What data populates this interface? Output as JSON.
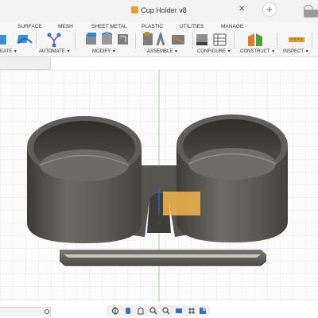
{
  "window": {
    "title": "Cup Holder v8",
    "close_glyph": "✕",
    "new_tab_glyph": "+"
  },
  "toolbar": {
    "tabs": [
      "SURFACE",
      "MESH",
      "SHEET METAL",
      "PLASTIC",
      "UTILITIES",
      "MANAGE"
    ],
    "groups": {
      "create": "EATE",
      "automate": "AUTOMATE",
      "modify": "MODIFY",
      "assemble": "ASSEMBLE",
      "configure": "CONFIGURE",
      "construct": "CONSTRUCT",
      "inspect": "INSPECT"
    }
  },
  "icons": {
    "title": "cube-icon",
    "navigation": [
      "orbit-icon",
      "pan-icon",
      "look-at-icon",
      "zoom-icon",
      "zoom-window-icon",
      "display-settings-icon",
      "grid-settings-icon",
      "viewport-icon"
    ]
  },
  "colors": {
    "accent": "#f29b33",
    "selection_fill": "#f5b64a",
    "body_dark": "#4a4a45",
    "body_light": "#6f6e69",
    "grid_line": "#e6e6e6",
    "axis_green": "#a7d29a"
  }
}
